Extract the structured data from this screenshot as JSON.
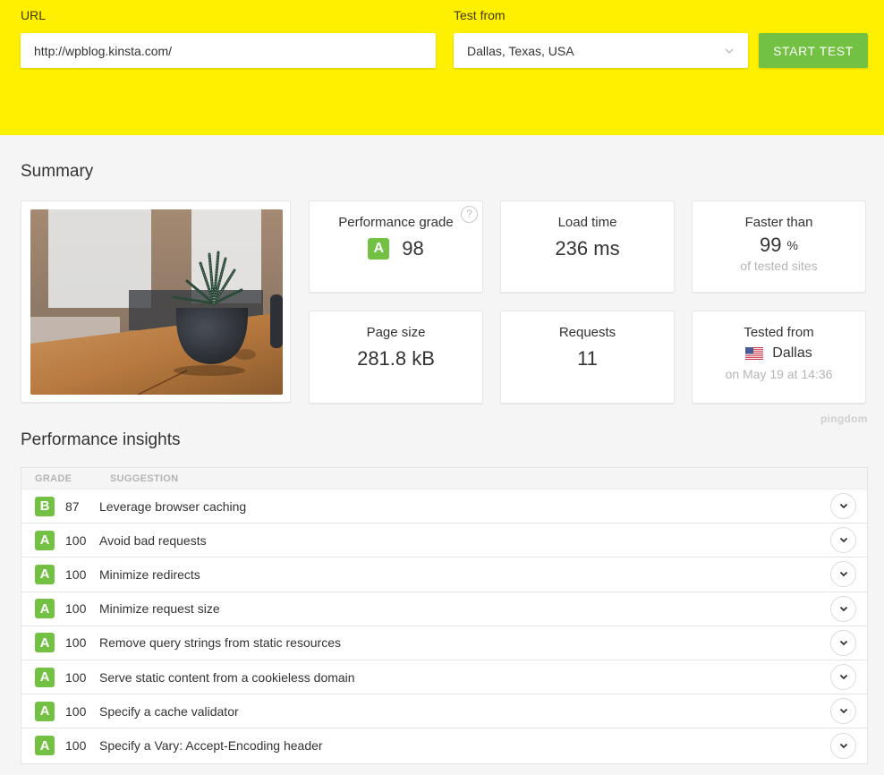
{
  "header": {
    "url_label": "URL",
    "url_value": "http://wpblog.kinsta.com/",
    "test_from_label": "Test from",
    "test_from_value": "Dallas, Texas, USA",
    "start_button": "START TEST",
    "accent_color": "#fff000",
    "button_color": "#73c143"
  },
  "summary": {
    "title": "Summary",
    "screenshot_alt": "Website screenshot preview - potted succulent plant on wooden table",
    "cards": {
      "performance_grade": {
        "label": "Performance grade",
        "grade": "A",
        "value": "98",
        "help_icon": "?"
      },
      "load_time": {
        "label": "Load time",
        "value": "236 ms"
      },
      "faster_than": {
        "label": "Faster than",
        "value": "99",
        "unit": "%",
        "sub": "of tested sites"
      },
      "page_size": {
        "label": "Page size",
        "value": "281.8 kB"
      },
      "requests": {
        "label": "Requests",
        "value": "11"
      },
      "tested_from": {
        "label": "Tested from",
        "location": "Dallas",
        "flag": "us-flag",
        "sub": "on May 19 at 14:36"
      }
    },
    "brand": "pingdom"
  },
  "insights": {
    "title": "Performance insights",
    "columns": [
      "GRADE",
      "SUGGESTION"
    ],
    "rows": [
      {
        "grade": "B",
        "score": "87",
        "suggestion": "Leverage browser caching"
      },
      {
        "grade": "A",
        "score": "100",
        "suggestion": "Avoid bad requests"
      },
      {
        "grade": "A",
        "score": "100",
        "suggestion": "Minimize redirects"
      },
      {
        "grade": "A",
        "score": "100",
        "suggestion": "Minimize request size"
      },
      {
        "grade": "A",
        "score": "100",
        "suggestion": "Remove query strings from static resources"
      },
      {
        "grade": "A",
        "score": "100",
        "suggestion": "Serve static content from a cookieless domain"
      },
      {
        "grade": "A",
        "score": "100",
        "suggestion": "Specify a cache validator"
      },
      {
        "grade": "A",
        "score": "100",
        "suggestion": "Specify a Vary: Accept-Encoding header"
      }
    ]
  }
}
